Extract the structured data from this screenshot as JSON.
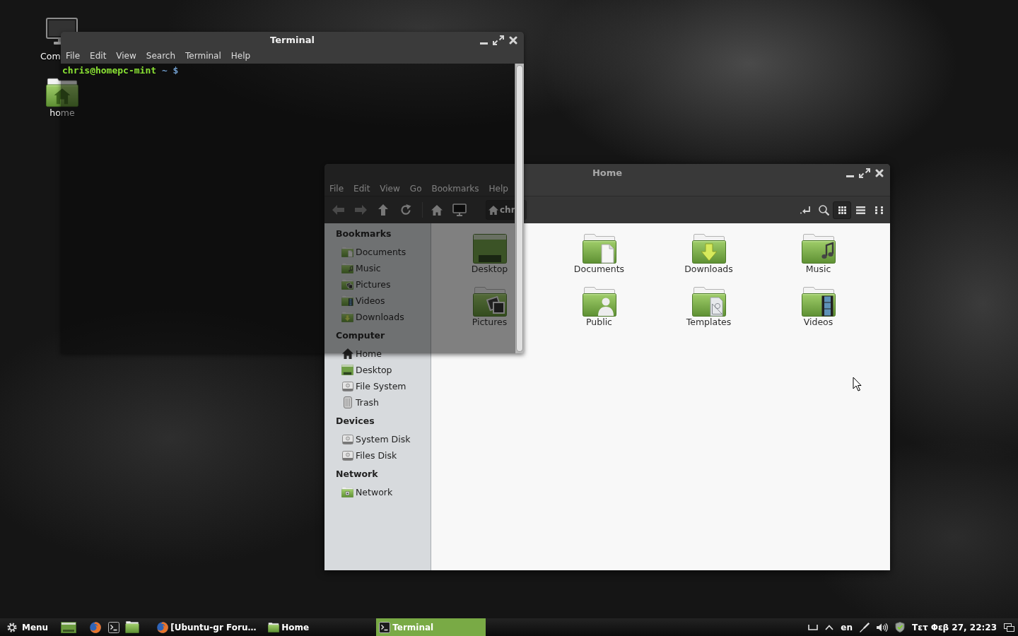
{
  "desktop": {
    "icons": [
      {
        "kind": "computer",
        "label": "Com",
        "selected": false
      },
      {
        "kind": "home",
        "label": "home",
        "selected": false
      }
    ]
  },
  "terminal": {
    "window": {
      "title": "Terminal",
      "active": true
    },
    "menu": [
      "File",
      "Edit",
      "View",
      "Search",
      "Terminal",
      "Help"
    ],
    "prompt": {
      "user_host": "chris@homepc-mint",
      "path": "~",
      "symbol": "$"
    }
  },
  "file_manager": {
    "window": {
      "title": "Home",
      "active": false
    },
    "menu": [
      "File",
      "Edit",
      "View",
      "Go",
      "Bookmarks",
      "Help"
    ],
    "toolbar": {
      "nav_buttons": [
        {
          "kind": "back",
          "disabled": true
        },
        {
          "kind": "forward",
          "disabled": true
        },
        {
          "kind": "up",
          "disabled": false
        },
        {
          "kind": "reload",
          "disabled": false
        }
      ],
      "place_buttons": [
        {
          "kind": "home"
        },
        {
          "kind": "computer"
        }
      ],
      "path": [
        {
          "label": "chr",
          "selected": true
        }
      ],
      "tools": [
        {
          "kind": "location"
        },
        {
          "kind": "search"
        }
      ],
      "views": [
        {
          "kind": "icons",
          "selected": true
        },
        {
          "kind": "list",
          "selected": false
        },
        {
          "kind": "compact",
          "selected": false
        }
      ]
    },
    "sidebar": {
      "sections": [
        {
          "heading": "Bookmarks",
          "items": [
            {
              "label": "Documents",
              "kind": "documents",
              "selected": false
            },
            {
              "label": "Music",
              "kind": "music",
              "selected": false
            },
            {
              "label": "Pictures",
              "kind": "pictures",
              "selected": false
            },
            {
              "label": "Videos",
              "kind": "videos",
              "selected": false
            },
            {
              "label": "Downloads",
              "kind": "downloads",
              "selected": false
            }
          ]
        },
        {
          "heading": "Computer",
          "items": [
            {
              "label": "Home",
              "kind": "home",
              "selected": false
            },
            {
              "label": "Desktop",
              "kind": "desktop",
              "selected": false
            },
            {
              "label": "File System",
              "kind": "drive",
              "selected": false
            },
            {
              "label": "Trash",
              "kind": "trash",
              "selected": false
            }
          ]
        },
        {
          "heading": "Devices",
          "items": [
            {
              "label": "System Disk",
              "kind": "drive",
              "selected": false
            },
            {
              "label": "Files Disk",
              "kind": "drive",
              "selected": false
            }
          ]
        },
        {
          "heading": "Network",
          "items": [
            {
              "label": "Network",
              "kind": "network",
              "selected": false
            }
          ]
        }
      ]
    },
    "files": [
      {
        "label": "Desktop",
        "kind": "desktop",
        "selected": false
      },
      {
        "label": "Documents",
        "kind": "documents",
        "selected": false
      },
      {
        "label": "Downloads",
        "kind": "downloads",
        "selected": false
      },
      {
        "label": "Music",
        "kind": "music",
        "selected": false
      },
      {
        "label": "Pictures",
        "kind": "pictures",
        "selected": false
      },
      {
        "label": "Public",
        "kind": "public",
        "selected": false
      },
      {
        "label": "Templates",
        "kind": "templates",
        "selected": false
      },
      {
        "label": "Videos",
        "kind": "videos",
        "selected": false
      }
    ]
  },
  "taskbar": {
    "menu_button": {
      "label": "Menu"
    },
    "launchers": [
      {
        "kind": "show-desktop"
      },
      {
        "kind": "browser"
      },
      {
        "kind": "terminal"
      },
      {
        "kind": "files"
      }
    ],
    "windows": [
      {
        "label": "[Ubuntu-gr Foru…",
        "kind": "browser",
        "selected": false
      },
      {
        "label": "Home",
        "kind": "folder",
        "selected": false
      },
      {
        "label": "Terminal",
        "kind": "terminal",
        "selected": true
      }
    ],
    "tray": [
      {
        "kind": "bracket"
      },
      {
        "kind": "caret"
      },
      {
        "kind": "layout",
        "label": "en"
      },
      {
        "kind": "pen"
      },
      {
        "kind": "volume"
      },
      {
        "kind": "shield"
      },
      {
        "kind": "clock",
        "label": "Τετ Φεβ 27, 22:23"
      },
      {
        "kind": "windows"
      }
    ]
  }
}
